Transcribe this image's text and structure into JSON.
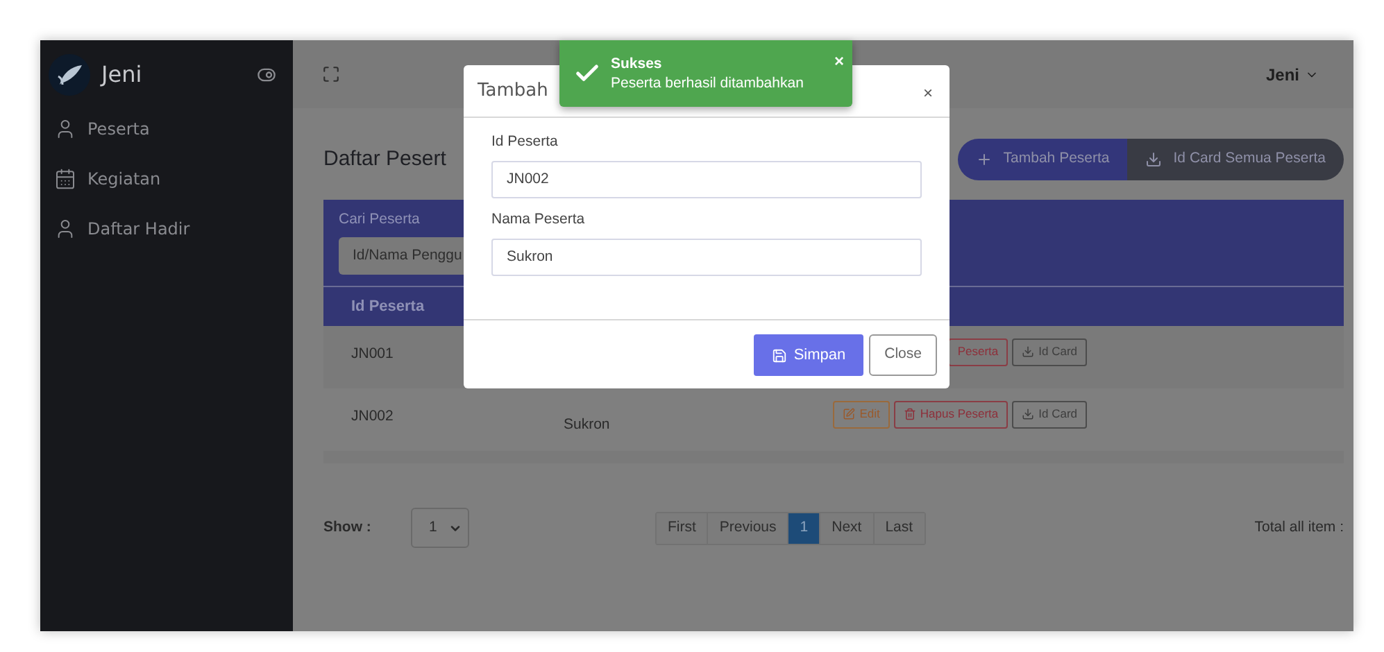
{
  "sidebar": {
    "brand": "Jeni",
    "items": [
      {
        "label": "Peserta",
        "kind": "user"
      },
      {
        "label": "Kegiatan",
        "kind": "calendar"
      },
      {
        "label": "Daftar Hadir",
        "kind": "user"
      }
    ]
  },
  "topbar": {
    "user": "Jeni"
  },
  "page": {
    "title": "Daftar Pesert",
    "actions": [
      {
        "kind": "add",
        "label": "Tambah Peserta"
      },
      {
        "kind": "download",
        "label": "Id Card Semua Peserta"
      }
    ]
  },
  "search": {
    "label": "Cari Peserta",
    "placeholder": "Id/Nama Penggu"
  },
  "table": {
    "columns": [
      "Id Peserta"
    ],
    "rows": [
      {
        "id": "JN001",
        "actions": [
          {
            "kind": "delete",
            "label": "Peserta"
          },
          {
            "kind": "idcard",
            "label": "Id Card"
          }
        ]
      },
      {
        "id": "JN002",
        "name": "Sukron",
        "actions": [
          {
            "kind": "edit",
            "label": "Edit"
          },
          {
            "kind": "delete",
            "label": "Hapus Peserta"
          },
          {
            "kind": "idcard",
            "label": "Id Card"
          }
        ]
      }
    ]
  },
  "pagination": {
    "show_label": "Show :",
    "show_value": "1",
    "pages": [
      {
        "label": "First",
        "selected": false
      },
      {
        "label": "Previous",
        "selected": false
      },
      {
        "label": "1",
        "selected": true
      },
      {
        "label": "Next",
        "selected": false
      },
      {
        "label": "Last",
        "selected": false
      }
    ],
    "total_label": "Total all item :"
  },
  "modal": {
    "title": "Tambah",
    "close": "×",
    "fields": [
      {
        "label": "Id Peserta",
        "value": "JN002"
      },
      {
        "label": "Nama Peserta",
        "value": "Sukron"
      }
    ],
    "save": "Simpan",
    "cancel": "Close"
  },
  "toast": {
    "title": "Sukses",
    "message": "Peserta berhasil ditambahkan",
    "close": "×"
  }
}
